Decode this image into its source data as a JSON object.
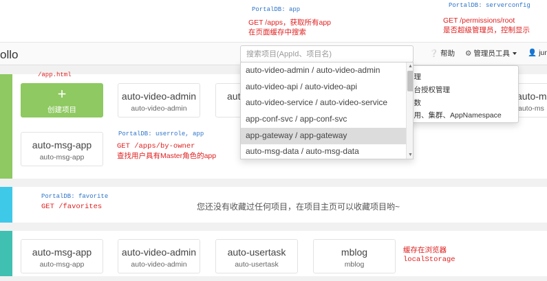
{
  "annotations": {
    "portaldb_app": "PortalDB: app",
    "get_apps": "GET /apps，获取所有app",
    "cache_search": "在页面缓存中搜索",
    "portaldb_serverconfig": "PortalDB: serverconfig",
    "get_permissions": "GET /permissions/root",
    "is_super_admin": "是否超级管理员，控制显示",
    "app_html": "/app.html",
    "portaldb_userrole": "PortalDB: userrole, app",
    "get_apps_by_owner": "GET /apps/by-owner",
    "find_master_apps": "查找用户具有Master角色的app",
    "portaldb_favorite": "PortalDB: favorite",
    "get_favorites": "GET /favorites",
    "browser_cache": "缓存在浏览器",
    "local_storage": "localStorage"
  },
  "navbar": {
    "brand": "ollo",
    "search_placeholder": "搜索项目(AppId、项目名)",
    "help_label": "帮助",
    "admin_tools_label": "管理员工具",
    "user_label": "jun"
  },
  "search_dropdown": {
    "options": [
      "auto-video-admin / auto-video-admin",
      "auto-video-api / auto-video-api",
      "auto-video-service / auto-video-service",
      "app-conf-svc / app-conf-svc",
      "app-gateway / app-gateway",
      "auto-msg-data / auto-msg-data"
    ],
    "highlighted_index": 4
  },
  "admin_menu": {
    "items": [
      "管理",
      "平台授权管理",
      "参数",
      "应用、集群、AppNamespace"
    ]
  },
  "my_apps": {
    "create_label": "创建项目",
    "cards": [
      {
        "name": "auto-video-admin",
        "id": "auto-video-admin"
      },
      {
        "name": "aut",
        "id": ""
      },
      {
        "name": "auto-msg-app",
        "id": "auto-msg-app"
      }
    ],
    "right_partial": {
      "name": "auto-ms",
      "id": "auto-ms"
    }
  },
  "favorites": {
    "empty_text": "您还没有收藏过任何项目，在项目主页可以收藏项目哟~"
  },
  "recent_apps": {
    "cards": [
      {
        "name": "auto-msg-app",
        "id": "auto-msg-app"
      },
      {
        "name": "auto-video-admin",
        "id": "auto-video-admin"
      },
      {
        "name": "auto-usertask",
        "id": "auto-usertask"
      },
      {
        "name": "mblog",
        "id": "mblog"
      }
    ]
  },
  "colors": {
    "green": "#8ec961",
    "cyan": "#3fc9e8",
    "teal": "#3fc0b1",
    "annotation_red": "#e02020",
    "annotation_blue": "#2e75c9"
  }
}
